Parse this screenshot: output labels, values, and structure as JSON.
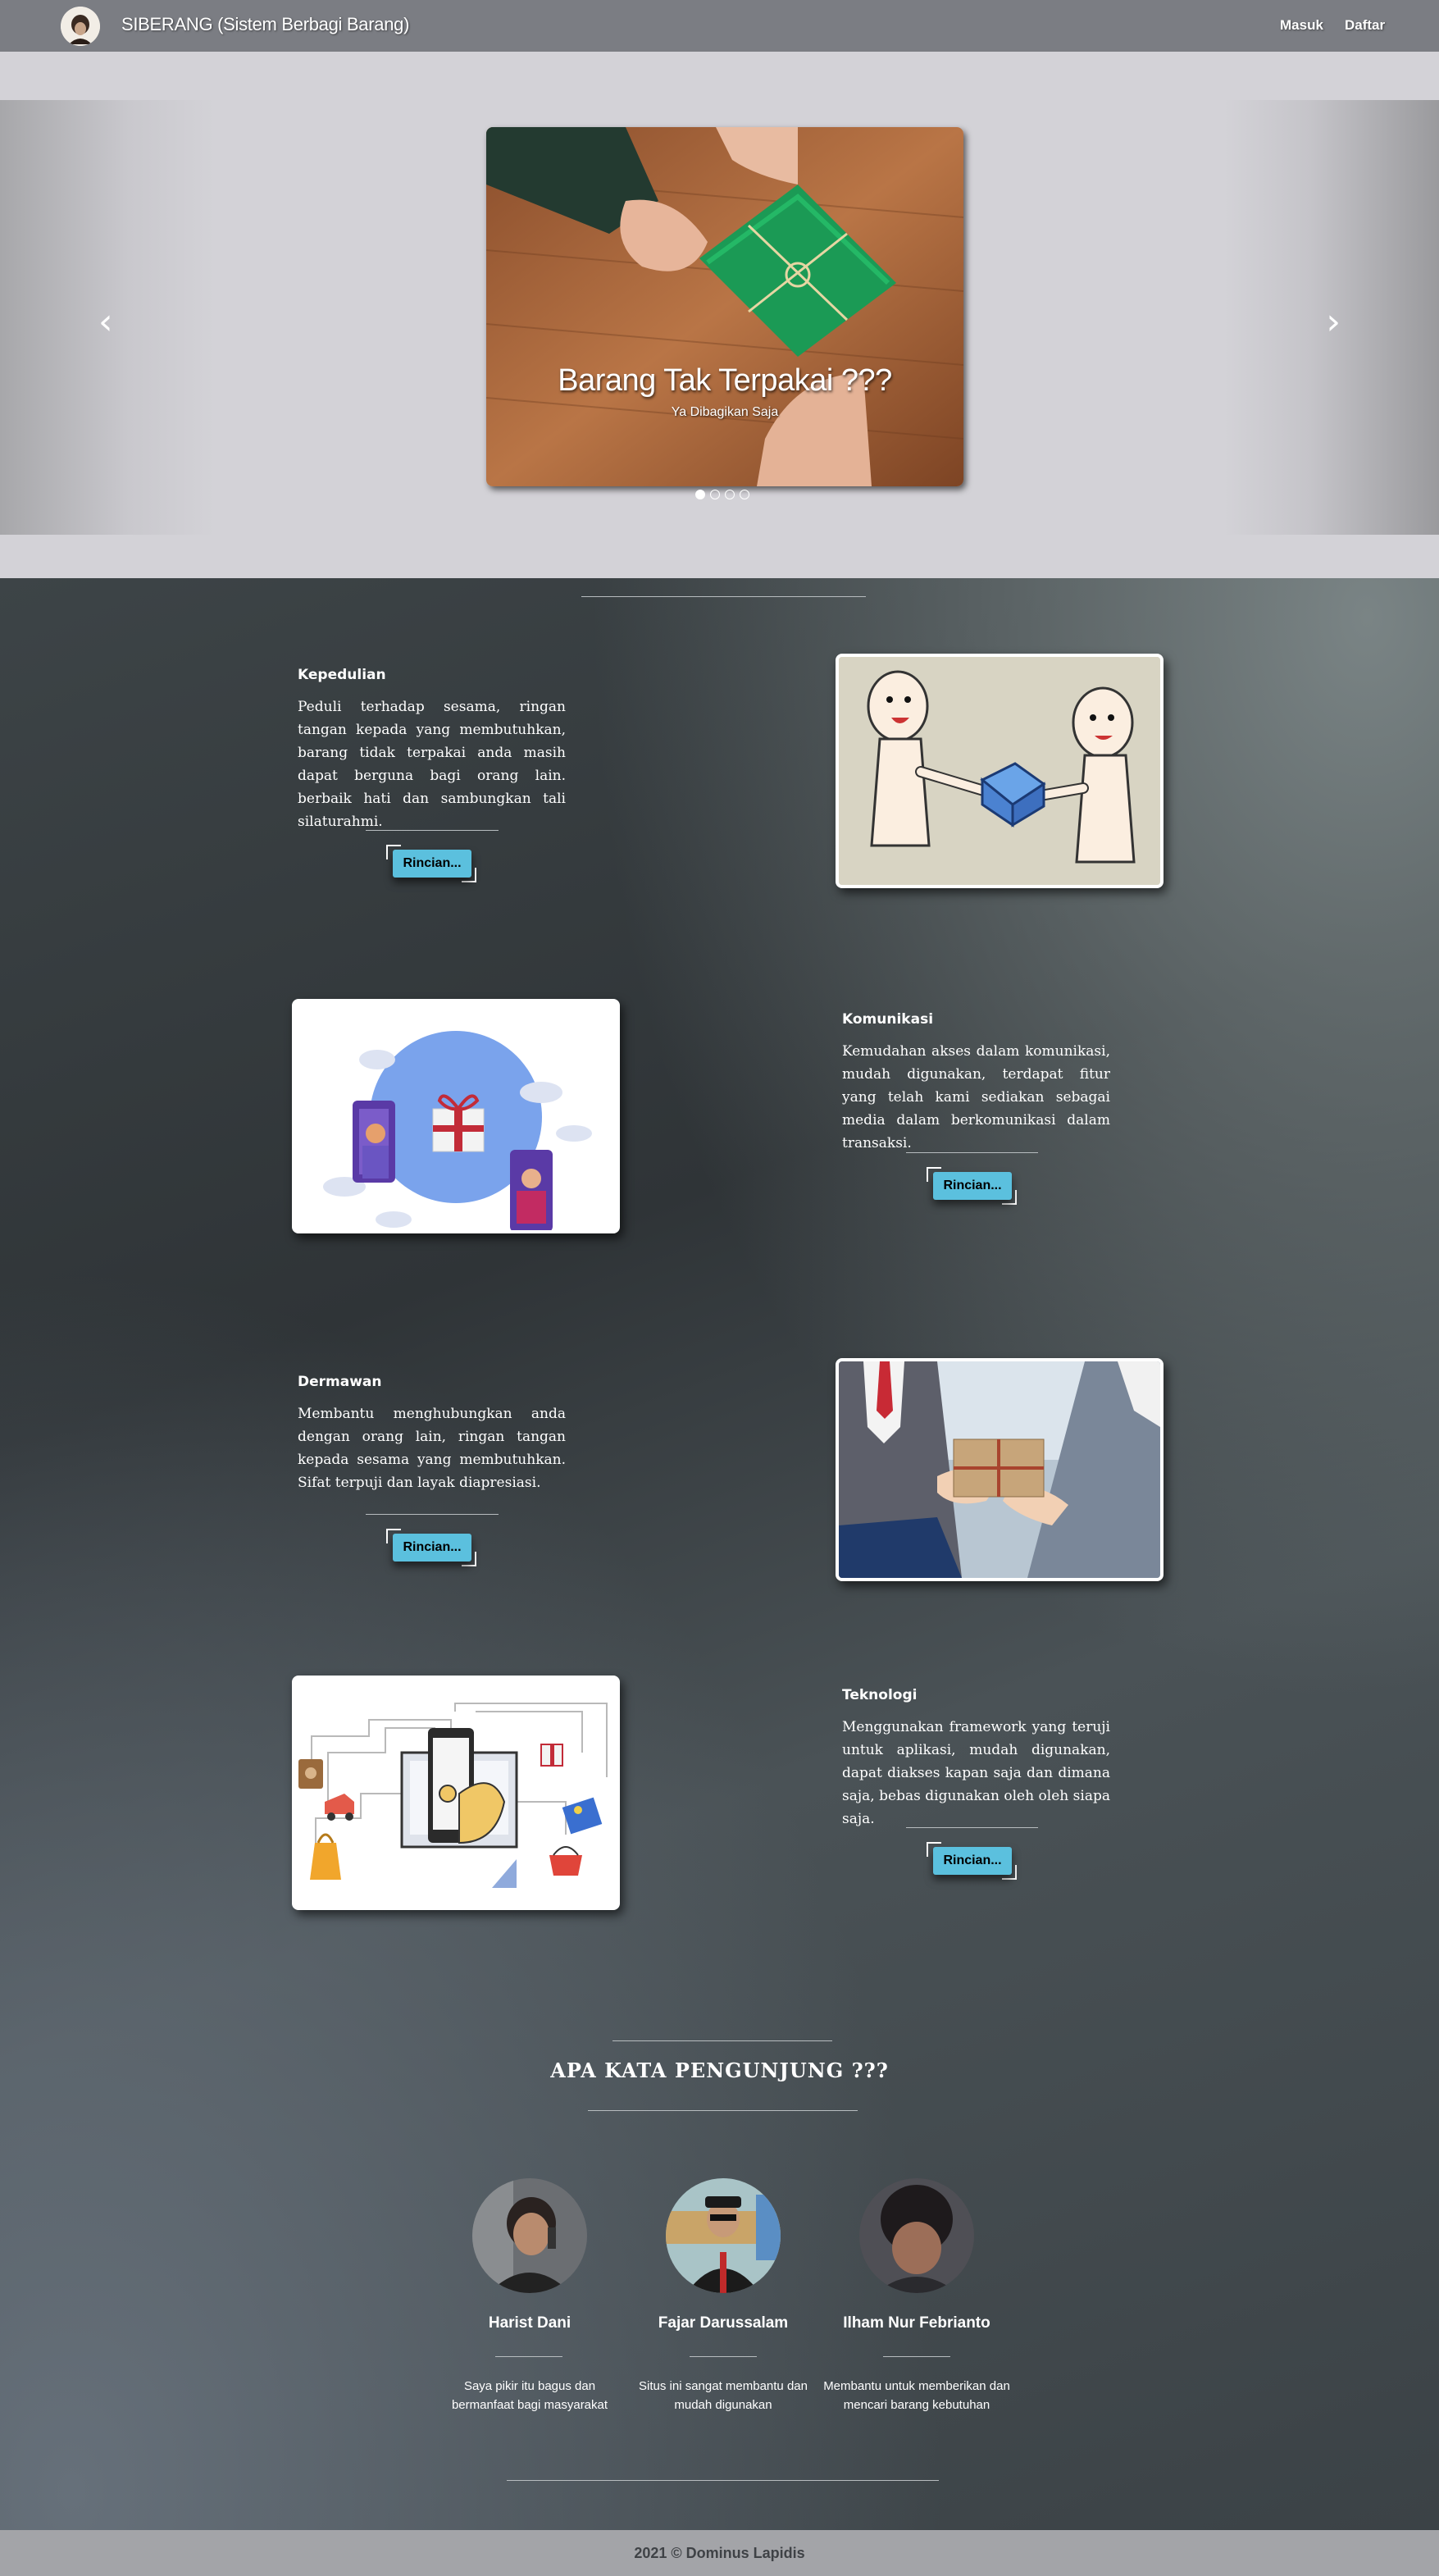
{
  "navbar": {
    "title": "SIBERANG (Sistem Berbagi Barang)",
    "login_label": "Masuk",
    "register_label": "Daftar"
  },
  "carousel": {
    "slide_title": "Barang Tak Terpakai ???",
    "slide_subtitle": "Ya Dibagikan Saja",
    "prev_icon": "chevron-left-icon",
    "next_icon": "chevron-right-icon",
    "prev_glyph": "‹",
    "next_glyph": "›",
    "slide_count": 4,
    "active_slide": 1
  },
  "features": [
    {
      "title": "Kepedulian",
      "text": "Peduli terhadap sesama, ringan tangan kepada yang membutuhkan, barang tidak terpakai anda masih dapat berguna bagi orang lain. berbaik hati dan sambungkan tali silaturahmi.",
      "button": "Rincian..."
    },
    {
      "title": "Komunikasi",
      "text": "Kemudahan akses dalam komunikasi, mudah digunakan, terdapat fitur yang telah kami sediakan sebagai media dalam berkomunikasi dalam transaksi.",
      "button": "Rincian..."
    },
    {
      "title": "Dermawan",
      "text": "Membantu menghubungkan anda dengan orang lain, ringan tangan kepada sesama yang membutuhkan. Sifat terpuji dan layak diapresiasi.",
      "button": "Rincian..."
    },
    {
      "title": "Teknologi",
      "text": "Menggunakan framework yang teruji untuk aplikasi, mudah digunakan, dapat diakses kapan saja dan dimana saja, bebas digunakan oleh oleh siapa saja.",
      "button": "Rincian..."
    }
  ],
  "testimonials": {
    "title": "APA KATA PENGUNJUNG ???",
    "items": [
      {
        "name": "Harist Dani",
        "text": "Saya pikir itu bagus dan bermanfaat bagi masyarakat"
      },
      {
        "name": "Fajar Darussalam",
        "text": "Situs ini sangat membantu dan mudah digunakan"
      },
      {
        "name": "Ilham Nur Febrianto",
        "text": "Membantu untuk memberikan dan mencari barang kebutuhan"
      }
    ]
  },
  "footer": {
    "text": "2021 © Dominus Lapidis"
  },
  "colors": {
    "navbar": "#7b7d83",
    "carousel_band": "#d3d2d7",
    "button": "#5bc0de",
    "footer": "#a3a4a8"
  }
}
